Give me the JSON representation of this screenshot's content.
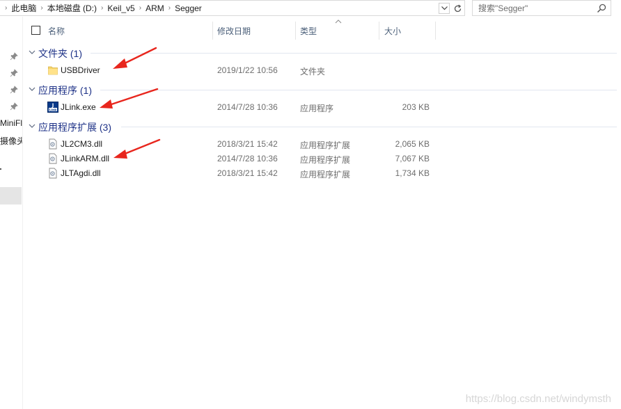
{
  "address_bar": {
    "breadcrumbs": [
      "此电脑",
      "本地磁盘 (D:)",
      "Keil_v5",
      "ARM",
      "Segger"
    ]
  },
  "search": {
    "placeholder": "搜索\"Segger\""
  },
  "nav_pane": {
    "partial_labels": [
      "MiniFl",
      "摄像头"
    ]
  },
  "columns": {
    "name": "名称",
    "date": "修改日期",
    "type": "类型",
    "size": "大小"
  },
  "groups": [
    {
      "label": "文件夹 (1)",
      "items": [
        {
          "name": "USBDriver",
          "date": "2019/1/22 10:56",
          "type": "文件夹",
          "size": "",
          "icon": "folder-icon"
        }
      ]
    },
    {
      "label": "应用程序 (1)",
      "items": [
        {
          "name": "JLink.exe",
          "date": "2014/7/28 10:36",
          "type": "应用程序",
          "size": "203 KB",
          "icon": "jlink-app-icon"
        }
      ]
    },
    {
      "label": "应用程序扩展 (3)",
      "items": [
        {
          "name": "JL2CM3.dll",
          "date": "2018/3/21 15:42",
          "type": "应用程序扩展",
          "size": "2,065 KB",
          "icon": "dll-file-icon"
        },
        {
          "name": "JLinkARM.dll",
          "date": "2014/7/28 10:36",
          "type": "应用程序扩展",
          "size": "7,067 KB",
          "icon": "dll-file-icon"
        },
        {
          "name": "JLTAgdi.dll",
          "date": "2018/3/21 15:42",
          "type": "应用程序扩展",
          "size": "1,734 KB",
          "icon": "dll-file-icon"
        }
      ]
    }
  ],
  "watermark": "https://blog.csdn.net/windymsth",
  "colors": {
    "group_header": "#1e3287",
    "annotation_arrow": "#e8261d",
    "nav_selection": "#e5e5e5"
  }
}
